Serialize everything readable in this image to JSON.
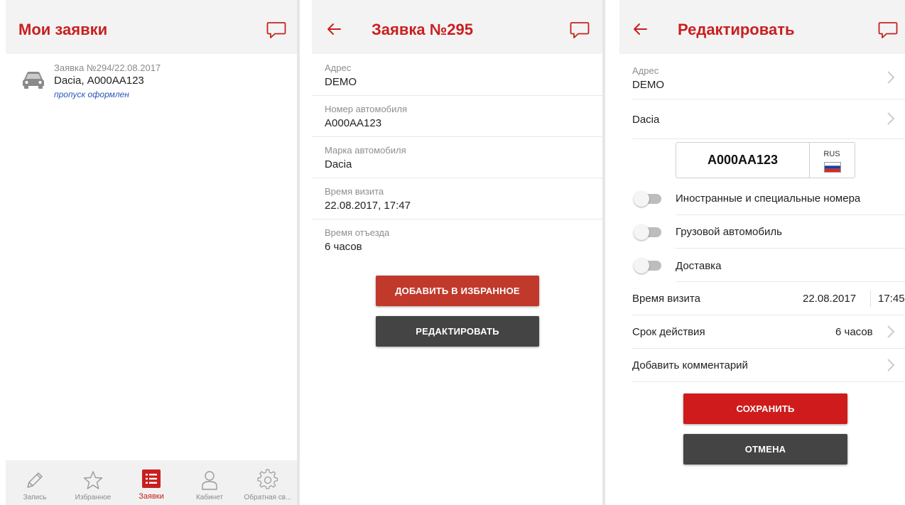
{
  "colors": {
    "brand": "#c8201f",
    "link": "#2a56b8",
    "dark_button": "#444444"
  },
  "screen1": {
    "title": "Мои заявки",
    "items": [
      {
        "title": "Заявка №294/22.08.2017",
        "main": "Dacia, А000АА123",
        "status": "пропуск оформлен",
        "icon": "car-icon"
      }
    ],
    "nav": [
      {
        "label": "Запись",
        "icon": "pencil-icon"
      },
      {
        "label": "Избранное",
        "icon": "star-icon"
      },
      {
        "label": "Заявки",
        "icon": "list-icon",
        "active": true
      },
      {
        "label": "Кабинет",
        "icon": "user-icon"
      },
      {
        "label": "Обратная св...",
        "icon": "gear-icon"
      }
    ]
  },
  "screen2": {
    "title": "Заявка №295",
    "fields": [
      {
        "label": "Адрес",
        "value": "DEMO"
      },
      {
        "label": "Номер автомобиля",
        "value": "А000АА123"
      },
      {
        "label": "Марка автомобиля",
        "value": "Dacia"
      },
      {
        "label": "Время визита",
        "value": "22.08.2017, 17:47"
      },
      {
        "label": "Время отъезда",
        "value": "6 часов"
      }
    ],
    "favorite_button": "ДОБАВИТЬ В ИЗБРАННОЕ",
    "edit_button": "РЕДАКТИРОВАТЬ"
  },
  "screen3": {
    "title": "Редактировать",
    "address_label": "Адрес",
    "address_value": "DEMO",
    "brand": "Dacia",
    "plate_number": "А000АА123",
    "plate_region": "RUS",
    "toggles": [
      {
        "label": "Иностранные и специальные номера",
        "on": false
      },
      {
        "label": "Грузовой автомобиль",
        "on": false
      },
      {
        "label": "Доставка",
        "on": false
      }
    ],
    "visit_label": "Время визита",
    "visit_date": "22.08.2017",
    "visit_time": "17:45",
    "validity_label": "Срок действия",
    "validity_value": "6 часов",
    "comment_label": "Добавить комментарий",
    "save_button": "СОХРАНИТЬ",
    "cancel_button": "ОТМЕНА"
  }
}
